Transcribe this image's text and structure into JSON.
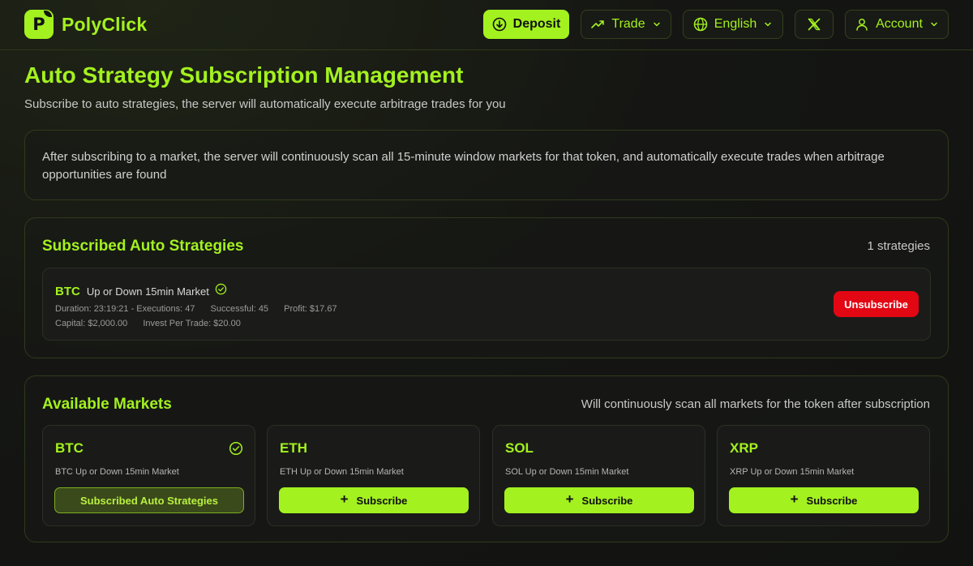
{
  "brand": {
    "name": "PolyClick",
    "logo_letter": "P"
  },
  "header": {
    "deposit_label": "Deposit",
    "trade_label": "Trade",
    "language_label": "English",
    "account_label": "Account"
  },
  "page": {
    "title": "Auto Strategy Subscription Management",
    "subtitle": "Subscribe to auto strategies, the server will automatically execute arbitrage trades for you"
  },
  "info": {
    "text": "After subscribing to a market, the server will continuously scan all 15-minute window markets for that token, and automatically execute trades when arbitrage opportunities are found"
  },
  "subscribed": {
    "title": "Subscribed Auto Strategies",
    "count": "1 strategies",
    "items": [
      {
        "token": "BTC",
        "market": "Up or Down 15min Market",
        "duration": "Duration: 23:19:21 - Executions: 47",
        "successful": "Successful: 45",
        "profit": "Profit: $17.67",
        "capital": "Capital: $2,000.00",
        "invest": "Invest Per Trade: $20.00",
        "action_label": "Unsubscribe"
      }
    ]
  },
  "available": {
    "title": "Available Markets",
    "note": "Will continuously scan all markets for the token after subscription",
    "markets": [
      {
        "token": "BTC",
        "desc": "BTC Up or Down 15min Market",
        "button": "Subscribed Auto Strategies",
        "subscribed": true
      },
      {
        "token": "ETH",
        "desc": "ETH Up or Down 15min Market",
        "button": "Subscribe",
        "subscribed": false
      },
      {
        "token": "SOL",
        "desc": "SOL Up or Down 15min Market",
        "button": "Subscribe",
        "subscribed": false
      },
      {
        "token": "XRP",
        "desc": "XRP Up or Down 15min Market",
        "button": "Subscribe",
        "subscribed": false
      }
    ]
  },
  "colors": {
    "accent": "#a3f11f",
    "danger": "#e30613",
    "background": "#141512"
  },
  "icons": [
    "download-circle-icon",
    "trending-up-icon",
    "globe-icon",
    "x-logo-icon",
    "user-icon",
    "chevron-down-icon",
    "check-circle-icon",
    "plus-icon"
  ]
}
